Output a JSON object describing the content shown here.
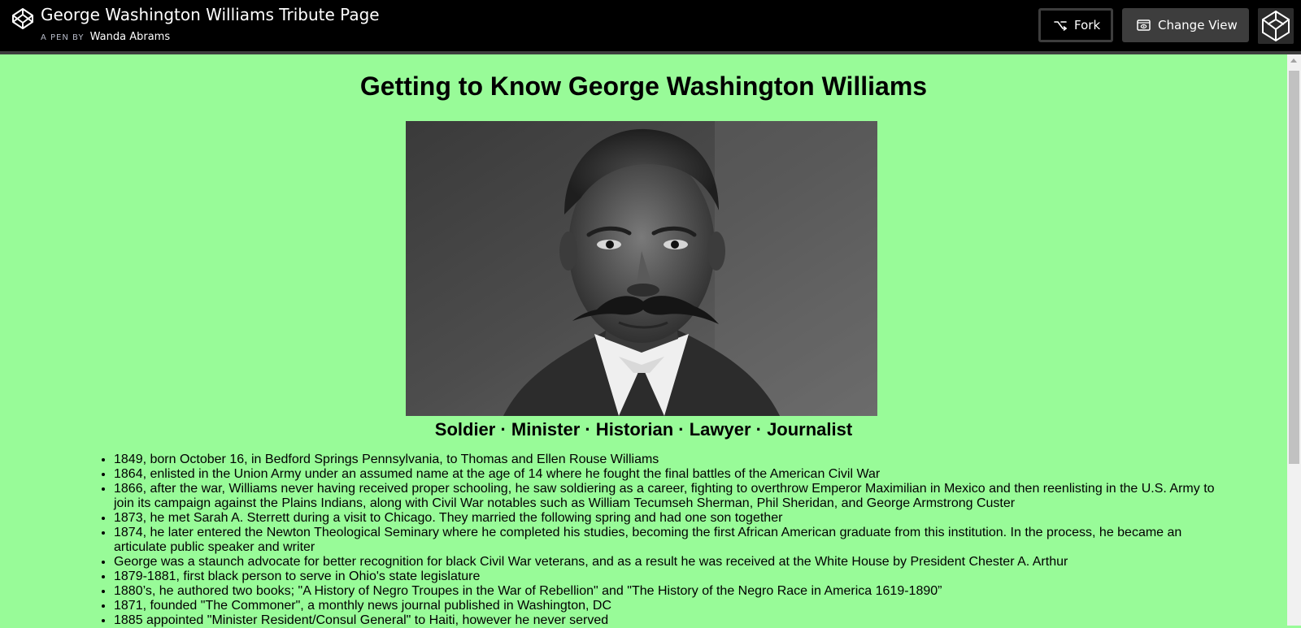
{
  "header": {
    "title": "George Washington Williams Tribute Page",
    "by_label": "A PEN BY",
    "author": "Wanda Abrams",
    "fork_label": "Fork",
    "change_view_label": "Change View"
  },
  "page": {
    "heading": "Getting to Know George Washington Williams",
    "caption": "Soldier · Minister · Historian · Lawyer · Journalist",
    "timeline": [
      "1849, born October 16, in Bedford Springs Pennsylvania, to Thomas and Ellen Rouse Williams",
      "1864, enlisted in the Union Army under an assumed name at the age of 14 where he fought the final battles of the American Civil War",
      "1866, after the war, Williams never having received proper schooling, he saw soldiering as a career, fighting to overthrow Emperor Maximilian in Mexico and then reenlisting in the U.S. Army to join its campaign against the Plains Indians, along with Civil War notables such as William Tecumseh Sherman, Phil Sheridan, and George Armstrong Custer",
      "1873, he met Sarah A. Sterrett during a visit to Chicago. They married the following spring and had one son together",
      "1874, he later entered the Newton Theological Seminary where he completed his studies, becoming the first African American graduate from this institution. In the process, he became an articulate public speaker and writer",
      "George was a staunch advocate for better recognition for black Civil War veterans, and as a result he was received at the White House by President Chester A. Arthur",
      "1879-1881, first black person to serve in Ohio's state legislature",
      "1880’s, he authored two books; \"A History of Negro Troupes in the War of Rebellion\" and \"The History of the Negro Race in America 1619-1890”",
      "1871, founded \"The Commoner\", a monthly news journal published in Washington, DC",
      "1885 appointed \"Minister Resident/Consul General\" to Haiti, however he never served"
    ]
  },
  "colors": {
    "background": "#98fb98",
    "topbar": "#000000",
    "button_dark": "#3d3d3d"
  },
  "icons": [
    "codepen-logo-icon",
    "fork-icon",
    "change-view-icon",
    "user-avatar"
  ]
}
